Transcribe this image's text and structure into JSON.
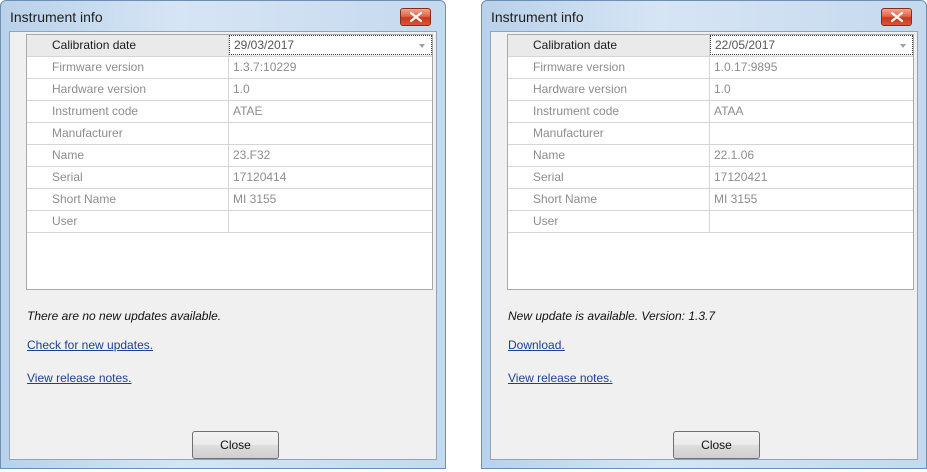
{
  "dialogs": [
    {
      "title": "Instrument info",
      "rows": [
        {
          "label": "Calibration date",
          "value": "29/03/2017"
        },
        {
          "label": "Firmware version",
          "value": "1.3.7:10229"
        },
        {
          "label": "Hardware version",
          "value": "1.0"
        },
        {
          "label": "Instrument code",
          "value": "ATAE"
        },
        {
          "label": "Manufacturer",
          "value": ""
        },
        {
          "label": "Name",
          "value": "23.F32"
        },
        {
          "label": "Serial",
          "value": "17120414"
        },
        {
          "label": "Short Name",
          "value": "MI 3155"
        },
        {
          "label": "User",
          "value": ""
        }
      ],
      "status": "There are no new updates available.",
      "link1": "Check for new updates.",
      "link2": "View release notes.",
      "close_label": "Close"
    },
    {
      "title": "Instrument info",
      "rows": [
        {
          "label": "Calibration date",
          "value": "22/05/2017"
        },
        {
          "label": "Firmware version",
          "value": "1.0.17:9895"
        },
        {
          "label": "Hardware version",
          "value": "1.0"
        },
        {
          "label": "Instrument code",
          "value": "ATAA"
        },
        {
          "label": "Manufacturer",
          "value": ""
        },
        {
          "label": "Name",
          "value": "22.1.06"
        },
        {
          "label": "Serial",
          "value": "17120421"
        },
        {
          "label": "Short Name",
          "value": "MI 3155"
        },
        {
          "label": "User",
          "value": ""
        }
      ],
      "status": "New update is available. Version: 1.3.7",
      "link1": "Download.",
      "link2": "View release notes.",
      "close_label": "Close"
    }
  ]
}
